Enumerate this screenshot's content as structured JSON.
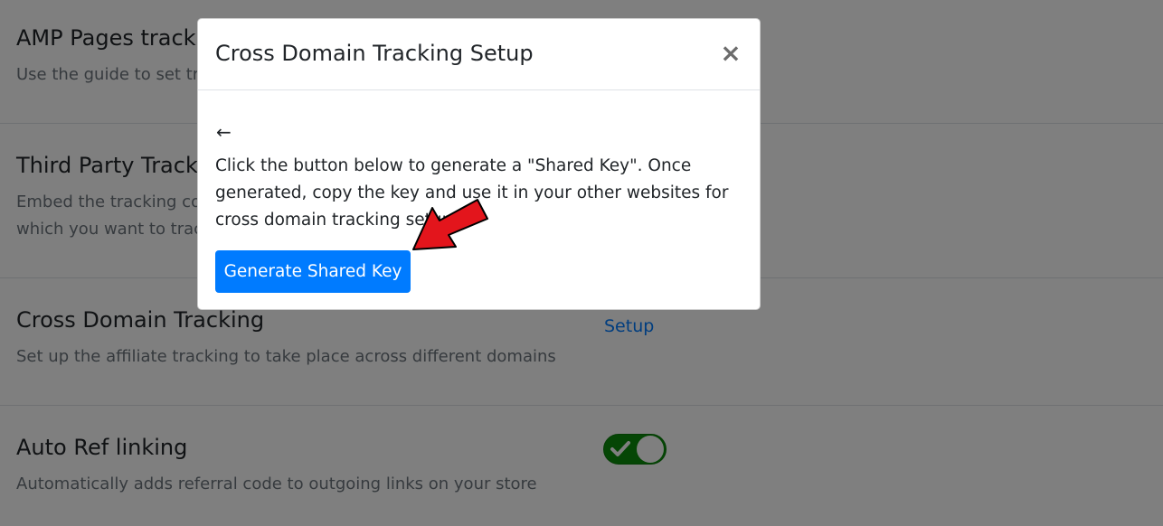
{
  "settings": {
    "amp": {
      "title": "AMP Pages tracking",
      "description": "Use the guide to set tracking on AMP pages"
    },
    "third_party": {
      "title": "Third Party Tracking",
      "description": "Embed the tracking code in any third party website or blog on which you want to track"
    },
    "cross_domain": {
      "title": "Cross Domain Tracking",
      "description": "Set up the affiliate tracking to take place across different domains",
      "link_label": "Setup"
    },
    "auto_ref": {
      "title": "Auto Ref linking",
      "description": "Automatically adds referral code to outgoing links on your store",
      "toggle_on": true
    }
  },
  "modal": {
    "title": "Cross Domain Tracking Setup",
    "close_label": "×",
    "back_label": "←",
    "body_text": "Click the button below to generate a \"Shared Key\". Once generated, copy the key and use it in your other websites for cross domain tracking setup.",
    "button_label": "Generate Shared Key"
  },
  "colors": {
    "primary": "#007bff",
    "toggle_on": "#0b8c0b",
    "annotation_arrow": "#e3151c"
  }
}
